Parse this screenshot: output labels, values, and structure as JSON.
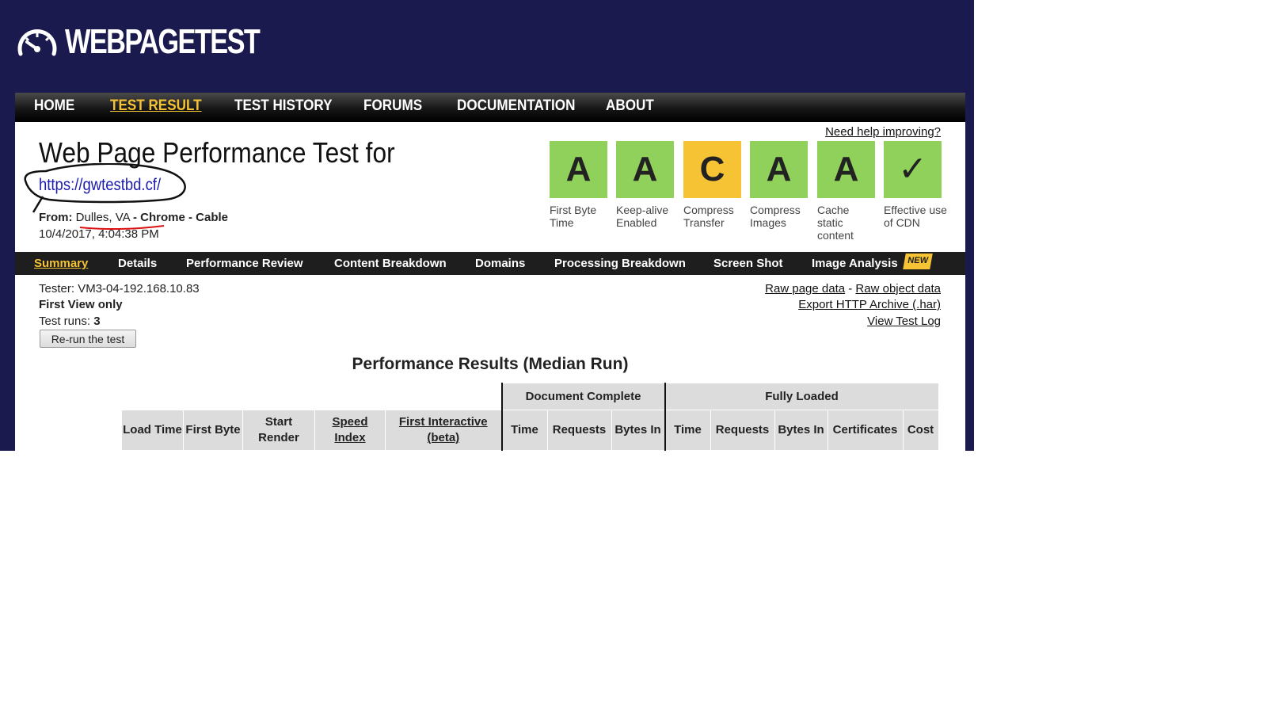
{
  "logo": {
    "text": "WEBPAGETEST",
    "icon": "speedometer-icon"
  },
  "topnav": {
    "items": [
      "HOME",
      "TEST RESULT",
      "TEST HISTORY",
      "FORUMS",
      "DOCUMENTATION",
      "ABOUT"
    ],
    "active": "TEST RESULT"
  },
  "header": {
    "title": "Web Page Performance Test for",
    "url": "https://gwtestbd.cf/",
    "from_label": "From:",
    "location": "Dulles, VA",
    "browser": "Chrome",
    "connection": "Cable",
    "sep": "-",
    "datetime": "10/4/2017, 4:04:38 PM",
    "help_link": "Need help improving?"
  },
  "grades": [
    {
      "letter": "A",
      "label": "First Byte Time",
      "color": "#8fd15a"
    },
    {
      "letter": "A",
      "label": "Keep-alive Enabled",
      "color": "#8fd15a"
    },
    {
      "letter": "C",
      "label": "Compress Transfer",
      "color": "#f5c334"
    },
    {
      "letter": "A",
      "label": "Compress Images",
      "color": "#8fd15a"
    },
    {
      "letter": "A",
      "label": "Cache static content",
      "color": "#8fd15a"
    },
    {
      "letter": "✓",
      "label": "Effective use of CDN",
      "color": "#8fd15a"
    }
  ],
  "subnav": {
    "items": [
      "Summary",
      "Details",
      "Performance Review",
      "Content Breakdown",
      "Domains",
      "Processing Breakdown",
      "Screen Shot",
      "Image Analysis"
    ],
    "active": "Summary",
    "badge": "NEW"
  },
  "tester": {
    "tester_label": "Tester:",
    "tester_value": "VM3-04-192.168.10.83",
    "view": "First View only",
    "runs_label": "Test runs:",
    "runs_value": "3",
    "rerun_button": "Re-run the test"
  },
  "right_links": {
    "raw_page": "Raw page data",
    "sep": "-",
    "raw_object": "Raw object data",
    "export_har": "Export HTTP Archive (.har)",
    "view_log": "View Test Log"
  },
  "results": {
    "title": "Performance Results (Median Run)",
    "group_document": "Document Complete",
    "group_fully": "Fully Loaded",
    "columns": {
      "load_time": "Load Time",
      "first_byte": "First Byte",
      "start_render": "Start Render",
      "speed_index": "Speed Index",
      "first_interactive": "First Interactive (beta)",
      "dc_time": "Time",
      "dc_requests": "Requests",
      "dc_bytes": "Bytes In",
      "fl_time": "Time",
      "fl_requests": "Requests",
      "fl_bytes": "Bytes In",
      "certificates": "Certificates",
      "cost": "Cost"
    }
  },
  "colors": {
    "header_bg": "#1b1a4f",
    "accent": "#f5c334",
    "grade_green": "#8fd15a",
    "link": "#1c1cb0"
  }
}
